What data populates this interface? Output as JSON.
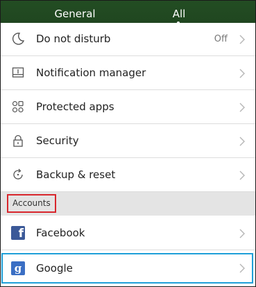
{
  "tabs": [
    {
      "label": "General",
      "active": false
    },
    {
      "label": "All",
      "active": true
    }
  ],
  "settings": [
    {
      "label": "Do not disturb",
      "value": "Off",
      "icon": "moon-icon"
    },
    {
      "label": "Notification manager",
      "icon": "notification-manager-icon"
    },
    {
      "label": "Protected apps",
      "icon": "protected-apps-icon"
    },
    {
      "label": "Security",
      "icon": "lock-icon"
    },
    {
      "label": "Backup & reset",
      "icon": "backup-reset-icon"
    }
  ],
  "accounts_section": {
    "label": "Accounts"
  },
  "accounts": [
    {
      "label": "Facebook",
      "icon": "facebook-icon",
      "glyph": "f"
    },
    {
      "label": "Google",
      "icon": "google-icon",
      "glyph": "g"
    }
  ],
  "colors": {
    "tab_bar": "#214a21",
    "section_highlight": "#d8262c",
    "row_highlight": "#1e9fd8",
    "facebook": "#3b5998",
    "google": "#3b6fc4"
  }
}
